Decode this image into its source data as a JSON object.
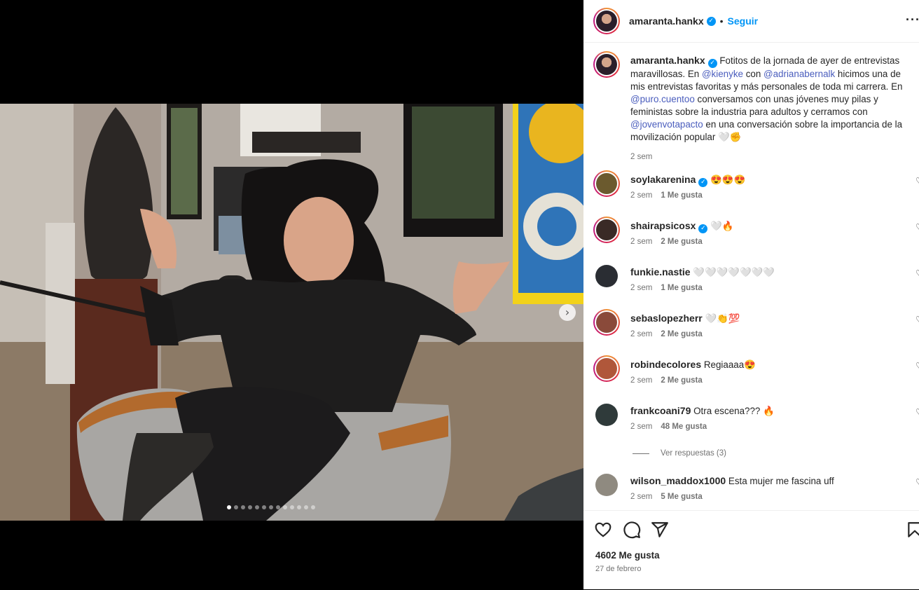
{
  "carousel": {
    "total_slides": 13,
    "active_slide": 1,
    "next_icon": "chevron-right"
  },
  "header": {
    "username": "amaranta.hankx",
    "separator": "•",
    "follow_label": "Seguir",
    "more_label": "···"
  },
  "caption": {
    "username": "amaranta.hankx",
    "segments": [
      {
        "text": "Fotitos de la jornada de ayer de entrevistas maravillosas. En "
      },
      {
        "text": "@kienyke",
        "mention": true
      },
      {
        "text": " con "
      },
      {
        "text": "@adrianabernalk",
        "mention": true
      },
      {
        "text": " hicimos una de mis entrevistas favoritas y más personales de toda mi carrera. En "
      },
      {
        "text": "@puro.cuentoo",
        "mention": true
      },
      {
        "text": " conversamos con unas jóvenes muy pilas y feministas sobre la industria para adultos y cerramos con "
      },
      {
        "text": "@jovenvotapacto",
        "mention": true
      },
      {
        "text": " en una conversación sobre la importancia de la movilización popular 🤍✊"
      }
    ],
    "time": "2 sem"
  },
  "comments": [
    {
      "username": "soylakarenina",
      "verified": true,
      "text": "😍😍😍",
      "time": "2 sem",
      "likes": "1 Me gusta",
      "ring": true,
      "avatar_color": "#6b5a2e"
    },
    {
      "username": "shairapsicosx",
      "verified": true,
      "text": "🤍🔥",
      "time": "2 sem",
      "likes": "2 Me gusta",
      "ring": true,
      "avatar_color": "#3a2a26"
    },
    {
      "username": "funkie.nastie",
      "verified": false,
      "text": "🤍🤍🤍🤍🤍🤍🤍",
      "time": "2 sem",
      "likes": "1 Me gusta",
      "ring": false,
      "avatar_color": "#2a2d33"
    },
    {
      "username": "sebaslopezherr",
      "verified": false,
      "text": "🤍👏💯",
      "time": "2 sem",
      "likes": "2 Me gusta",
      "ring": true,
      "avatar_color": "#8a4a3a"
    },
    {
      "username": "robindecolores",
      "verified": false,
      "text": "Regiaaaa😍",
      "time": "2 sem",
      "likes": "2 Me gusta",
      "ring": true,
      "avatar_color": "#b0573a"
    },
    {
      "username": "frankcoani79",
      "verified": false,
      "text": "Otra escena??? 🔥",
      "time": "2 sem",
      "likes": "48 Me gusta",
      "ring": false,
      "avatar_color": "#2f3a3a"
    },
    {
      "username": "wilson_maddox1000",
      "verified": false,
      "text": "Esta mujer me fascina uff",
      "time": "2 sem",
      "likes": "5 Me gusta",
      "ring": false,
      "avatar_color": "#8f8a80"
    }
  ],
  "view_replies": "Ver respuestas (3)",
  "actions": {
    "like_icon": "heart-icon",
    "comment_icon": "comment-icon",
    "share_icon": "share-icon",
    "save_icon": "bookmark-icon"
  },
  "likes": "4602 Me gusta",
  "date": "27 de febrero"
}
